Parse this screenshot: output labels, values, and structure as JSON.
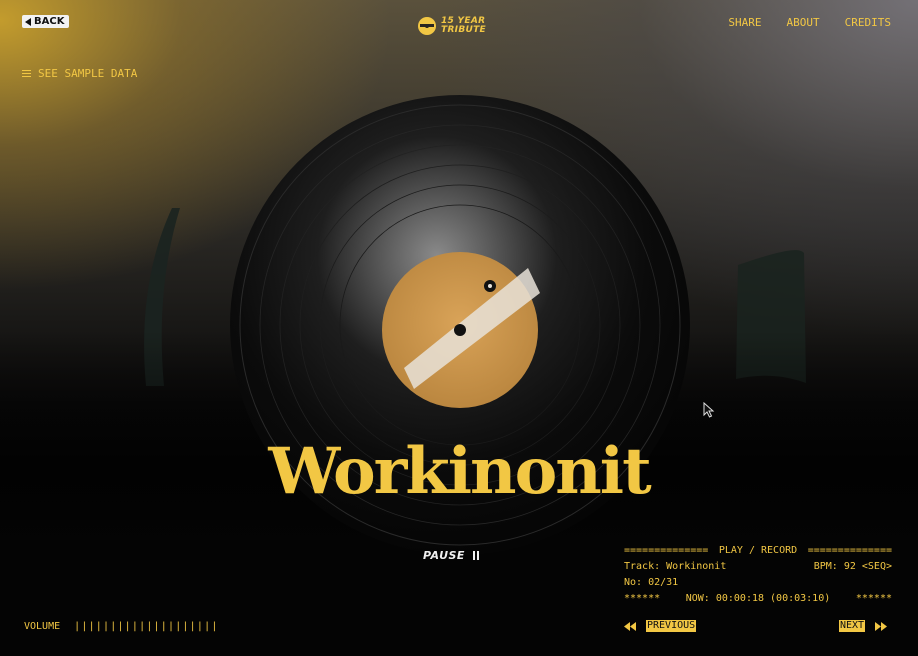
{
  "header": {
    "back_label": "BACK",
    "logo_line1": "15 YEAR",
    "logo_line2": "TRIBUTE",
    "nav": [
      "SHARE",
      "ABOUT",
      "CREDITS"
    ]
  },
  "sample_data_label": "SEE SAMPLE DATA",
  "track_title": "Workinonit",
  "pause_label": "PAUSE",
  "panel": {
    "left_rule": "==============",
    "heading": "PLAY / RECORD",
    "right_rule": "==============",
    "track_line": "Track: Workinonit",
    "bpm_line": "BPM: 92 <SEQ>",
    "number_line": "No: 02/31",
    "stars_left": "******",
    "now_line": "NOW: 00:00:18 (00:03:10)",
    "stars_right": "******"
  },
  "volume": {
    "label": "VOLUME",
    "bars": "||||||||||||||||||||"
  },
  "controls": {
    "previous_label": "PREVIOUS",
    "next_label": "NEXT"
  },
  "colors": {
    "accent": "#f2c744",
    "background": "#040404",
    "label_paper": "#c9954a"
  }
}
